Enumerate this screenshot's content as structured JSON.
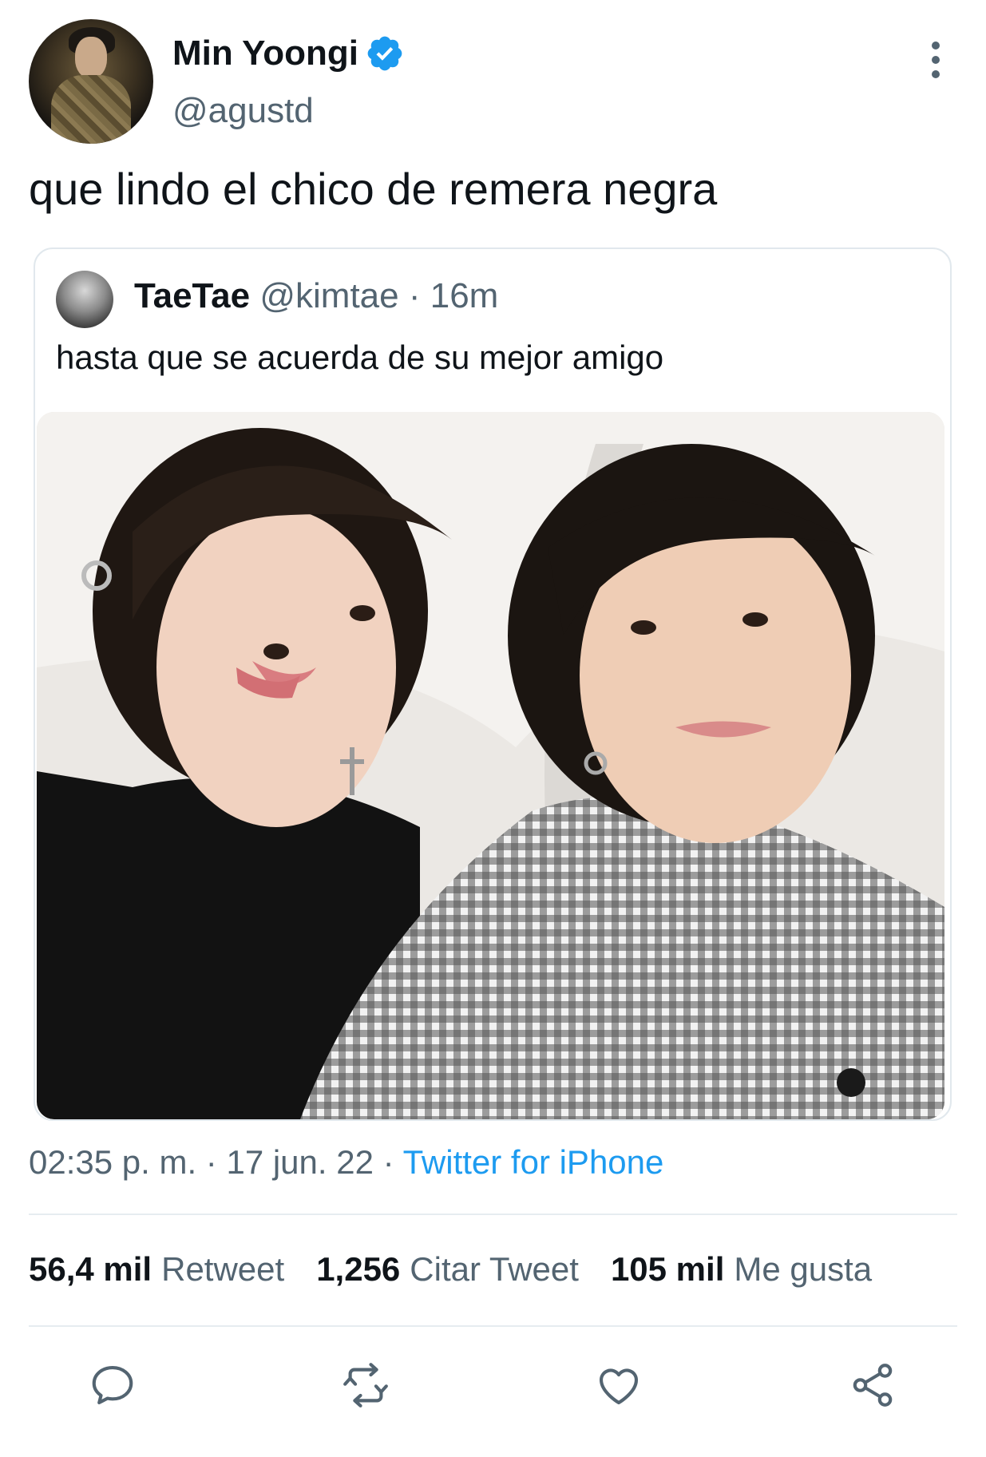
{
  "author": {
    "name": "Min Yoongi",
    "handle": "@agustd",
    "verified": true,
    "verified_color": "#1d9bf0"
  },
  "tweet": {
    "text": "que lindo el chico de remera negra",
    "time": "02:35 p. m.",
    "separator": "·",
    "date": "17 jun. 22",
    "source": "Twitter for iPhone"
  },
  "quote": {
    "name": "TaeTae",
    "handle": "@kimtae",
    "separator": "·",
    "age": "16m",
    "text": "hasta que se acuerda de su mejor amigo"
  },
  "stats": {
    "retweets_count": "56,4 mil",
    "retweets_label": "Retweet",
    "quotes_count": "1,256",
    "quotes_label": "Citar Tweet",
    "likes_count": "105 mil",
    "likes_label": "Me gusta"
  },
  "actions": {
    "icons": [
      "reply-icon",
      "retweet-icon",
      "like-icon",
      "share-icon"
    ],
    "icon_color": "#536471"
  },
  "colors": {
    "link": "#1d9bf0",
    "secondary_text": "#536471",
    "primary_text": "#0f1419",
    "border": "#e1e8ed"
  }
}
